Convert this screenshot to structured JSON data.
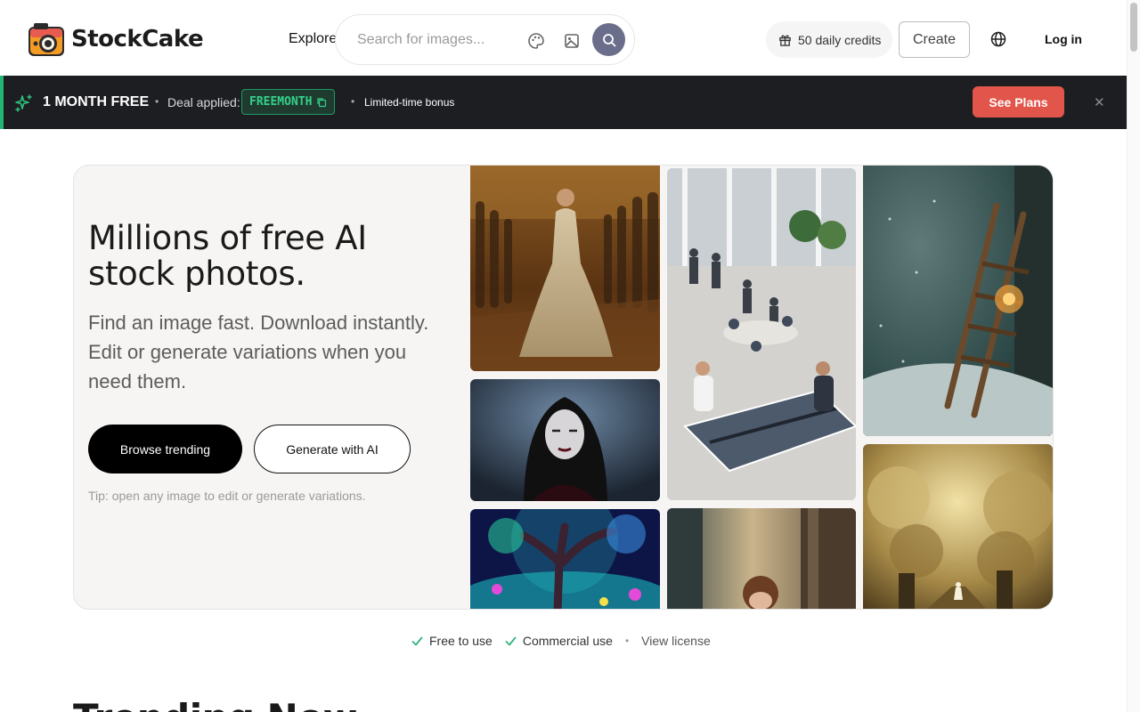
{
  "brand": {
    "name": "StockCake"
  },
  "nav": {
    "explore_label": "Explore"
  },
  "search": {
    "placeholder": "Search for images..."
  },
  "header": {
    "credits_label": "50 daily credits",
    "create_label": "Create",
    "login_label": "Log in"
  },
  "promo": {
    "headline": "1 MONTH FREE",
    "deal_label": "Deal applied:",
    "code": "FREEMONTH",
    "bonus": "Limited-time bonus",
    "cta": "See Plans",
    "close_glyph": "✕"
  },
  "hero": {
    "title": "Millions of free AI stock photos.",
    "subtitle": "Find an image fast. Download instantly. Edit or generate variations when you need them.",
    "primary_cta": "Browse trending",
    "secondary_cta": "Generate with AI",
    "tip": "Tip: open any image to edit or generate variations.",
    "images": [
      "royal-ball-gown-photo",
      "gothic-woman-portrait-photo",
      "glowing-fantasy-tree-photo",
      "office-ping-pong-photo",
      "girl-peeking-door-photo",
      "snowy-sled-lantern-photo",
      "golden-cloud-stairway-photo"
    ]
  },
  "license": {
    "free_label": "Free to use",
    "commercial_label": "Commercial use",
    "view_label": "View license"
  },
  "section": {
    "trending_title": "Trending Now"
  },
  "colors": {
    "promo_bg": "#1d1e22",
    "promo_accent": "#22b573",
    "cta_red": "#e2554a",
    "search_button": "#6b6e8a",
    "hero_bg": "#f6f5f3"
  }
}
